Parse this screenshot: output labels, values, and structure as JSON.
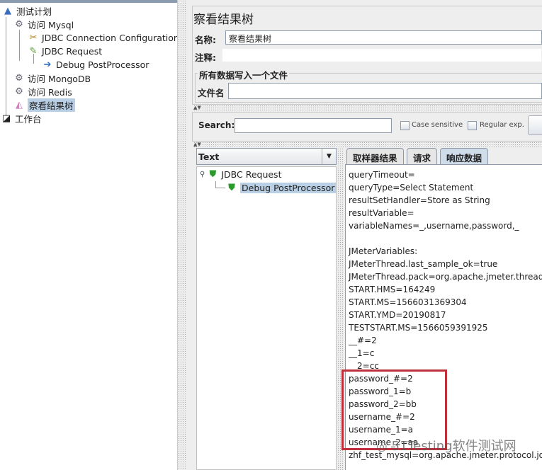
{
  "tree": {
    "items": [
      {
        "label": "测试计划",
        "icon": "flask-icon"
      },
      {
        "label": "访问 Mysql",
        "icon": "gear-icon"
      },
      {
        "label": "JDBC Connection Configuration",
        "icon": "wrench-screwdriver-icon"
      },
      {
        "label": "JDBC Request",
        "icon": "pipette-icon"
      },
      {
        "label": "Debug PostProcessor",
        "icon": "document-arrow-icon"
      },
      {
        "label": "访问 MongoDB",
        "icon": "gear-icon"
      },
      {
        "label": "访问 Redis",
        "icon": "gear-icon"
      },
      {
        "label": "察看结果树",
        "icon": "graph-icon"
      },
      {
        "label": "工作台",
        "icon": "workbench-icon"
      }
    ]
  },
  "panel": {
    "title": "察看结果树",
    "name_label": "名称:",
    "name_value": "察看结果树",
    "comment_label": "注释:",
    "comment_value": "",
    "group_title": "所有数据写入一个文件",
    "filename_label": "文件名",
    "filename_value": ""
  },
  "search": {
    "label": "Search:",
    "value": "",
    "case_sensitive": "Case sensitive",
    "regular_exp": "Regular exp."
  },
  "results": {
    "renderer": "Text",
    "tree": [
      {
        "label": "JDBC Request",
        "status": "success"
      },
      {
        "label": "Debug PostProcessor",
        "status": "success"
      }
    ],
    "tabs": [
      "取样器结果",
      "请求",
      "响应数据"
    ],
    "active_tab": "响应数据",
    "lines": [
      "queryTimeout=",
      "queryType=Select Statement",
      "resultSetHandler=Store as String",
      "resultVariable=",
      "variableNames=_,username,password,_",
      "",
      "JMeterVariables:",
      "JMeterThread.last_sample_ok=true",
      "JMeterThread.pack=org.apache.jmeter.threads.Sa",
      "START.HMS=164249",
      "START.MS=1566031369304",
      "START.YMD=20190817",
      "TESTSTART.MS=1566059391925",
      "__#=2",
      "__1=c",
      "__2=cc",
      "password_#=2",
      "password_1=b",
      "password_2=bb",
      "username_#=2",
      "username_1=a",
      "username_2=aa",
      "zhf_test_mysql=org.apache.jmeter.protocol.jdbc.c"
    ],
    "highlight_color": "#c0303a"
  },
  "watermark": "51Testing软件测试网"
}
